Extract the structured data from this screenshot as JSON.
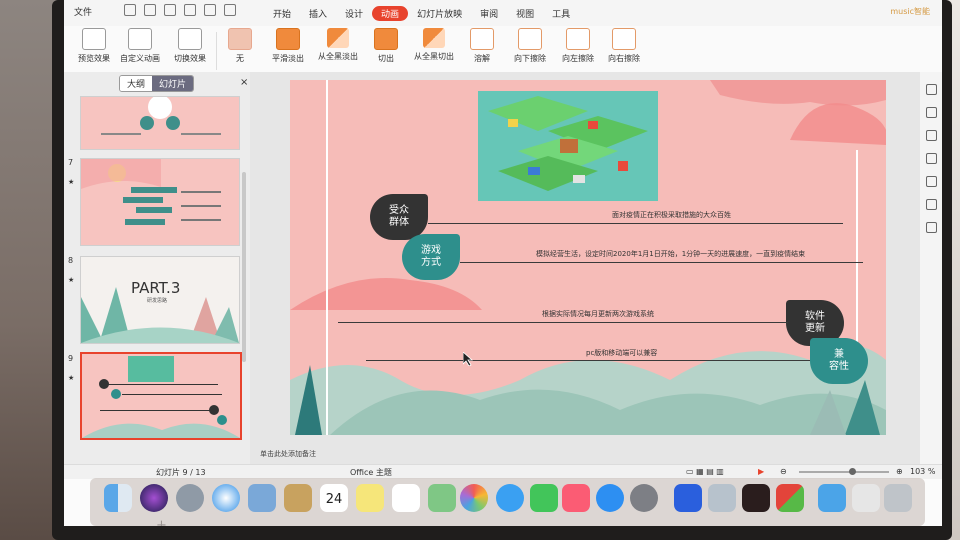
{
  "menubar": {
    "file_label": "文件",
    "tabs": [
      "开始",
      "插入",
      "设计",
      "动画",
      "幻灯片放映",
      "审阅",
      "视图",
      "工具"
    ],
    "active_tab": "动画",
    "brand": "music智能"
  },
  "ribbon": {
    "buttons": [
      "预览效果",
      "自定义动画",
      "切换效果",
      "无",
      "平滑淡出",
      "从全黑淡出",
      "切出",
      "从全黑切出",
      "溶解",
      "向下擦除",
      "向左擦除",
      "向右擦除"
    ],
    "colors": {
      "accent": "#e8432d",
      "transition_orange": "#f08a3c"
    }
  },
  "left_panel": {
    "tab_outline": "大纲",
    "tab_slides": "幻灯片",
    "close": "×",
    "slide_numbers": [
      "7",
      "8",
      "9"
    ],
    "thumb8_title": "PART.3",
    "thumb8_subtitle": "研发思路",
    "add_slide": "+"
  },
  "slide": {
    "tag1": "受众\n群体",
    "line1": "面对疫情正在积极采取措施的大众百姓",
    "tag2": "游戏\n方式",
    "line2": "模拟经营生活，设定时间2020年1月1日开始，1分钟一天的进展速度，一直到疫情结束",
    "tag3": "软件\n更新",
    "line3": "根据实际情况每月更新两次游戏系统",
    "tag4": "兼\n容性",
    "line4": "pc版和移动端可以兼容",
    "colors": {
      "background": "#f6bcb8",
      "dark_tag": "#333333",
      "teal_tag": "#2e8f8c"
    }
  },
  "notes_placeholder": "单击此处添加备注",
  "status": {
    "slide_counter": "幻灯片 9 / 13",
    "theme": "Office 主题",
    "zoom": "103 %"
  },
  "dock": {
    "icon_names": [
      "finder-icon",
      "siri-icon",
      "launchpad-icon",
      "safari-icon",
      "preview-icon",
      "notes-app-icon",
      "calendar-icon",
      "stickies-icon",
      "reminders-icon",
      "maps-icon",
      "photos-icon",
      "messages-icon",
      "facetime-icon",
      "music-icon",
      "app-store-icon",
      "system-preferences-icon",
      "wps-icon",
      "image-capture-icon",
      "flash-icon",
      "app-icon",
      "folder-icon",
      "docs-icon",
      "trash-icon"
    ],
    "calendar_day": "24"
  }
}
